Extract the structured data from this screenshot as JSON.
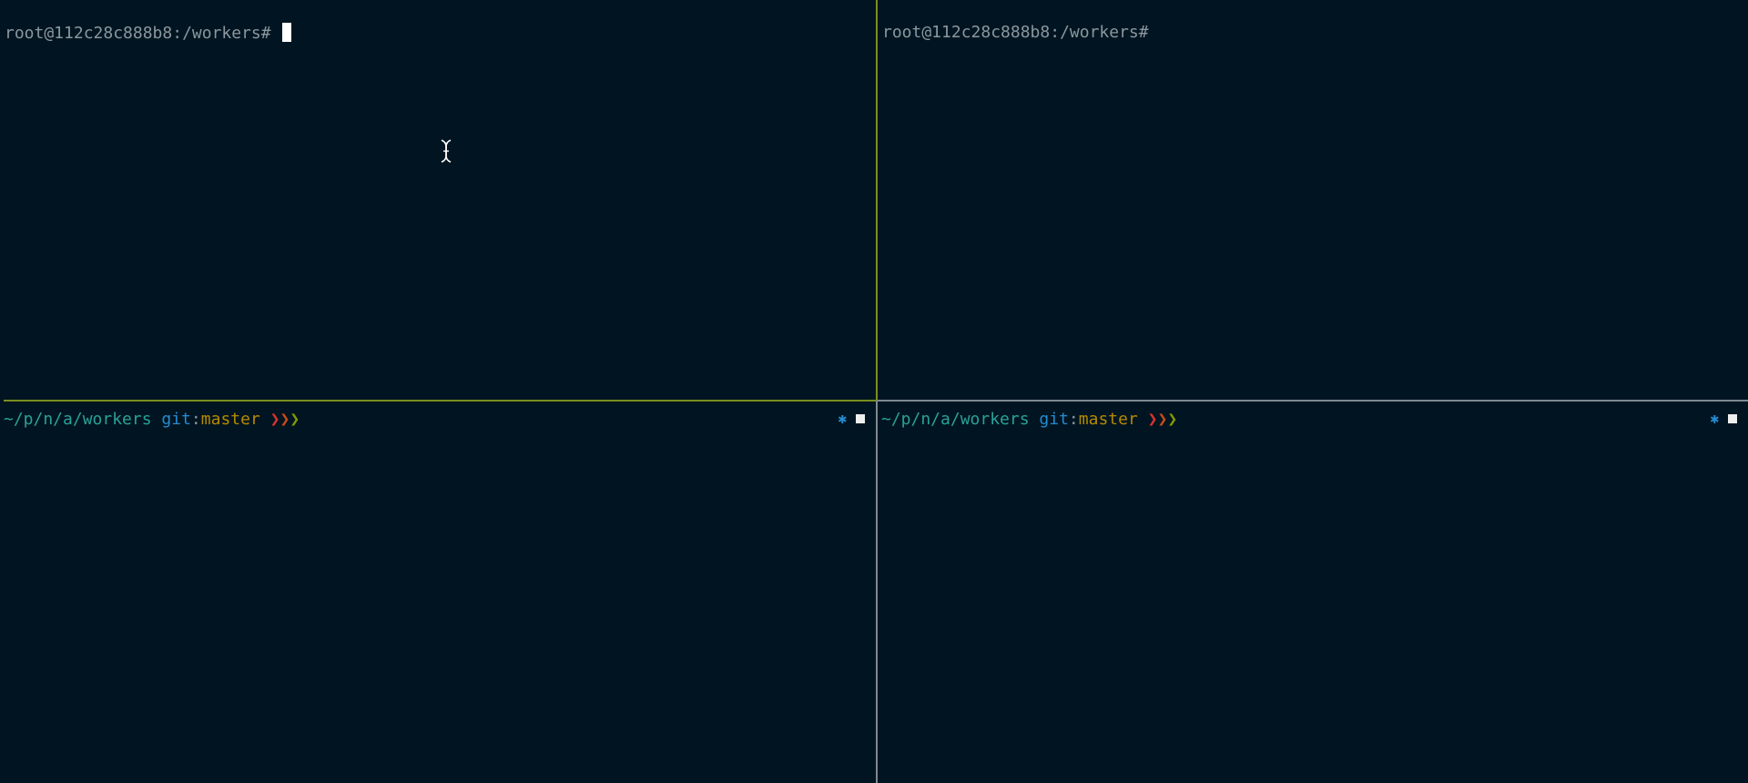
{
  "panes": {
    "top_left": {
      "prompt": "root@112c28c888b8:/workers# "
    },
    "top_right": {
      "prompt": "root@112c28c888b8:/workers#"
    },
    "bottom_left": {
      "cwd": "~/p/n/a/workers",
      "git_label": "git",
      "git_sep": ":",
      "branch": "master",
      "arrows": [
        "❯",
        "❯",
        "❯"
      ],
      "status_icons": [
        "gear-star-icon",
        "square-icon"
      ]
    },
    "bottom_right": {
      "cwd": "~/p/n/a/workers",
      "git_label": "git",
      "git_sep": ":",
      "branch": "master",
      "arrows": [
        "❯",
        "❯",
        "❯"
      ],
      "status_icons": [
        "gear-star-icon",
        "square-icon"
      ]
    }
  },
  "status_glyphs": {
    "star": "✱"
  },
  "colors": {
    "background": "#001521",
    "active_divider": "#7a8f1e",
    "inactive_divider": "#7d8a92",
    "prompt_text": "#8b979e",
    "cwd": "#2aa198",
    "git_label": "#268bd2",
    "branch": "#b58900",
    "arrow_1": "#dc322f",
    "arrow_2": "#cb4b16",
    "arrow_3": "#859900"
  }
}
